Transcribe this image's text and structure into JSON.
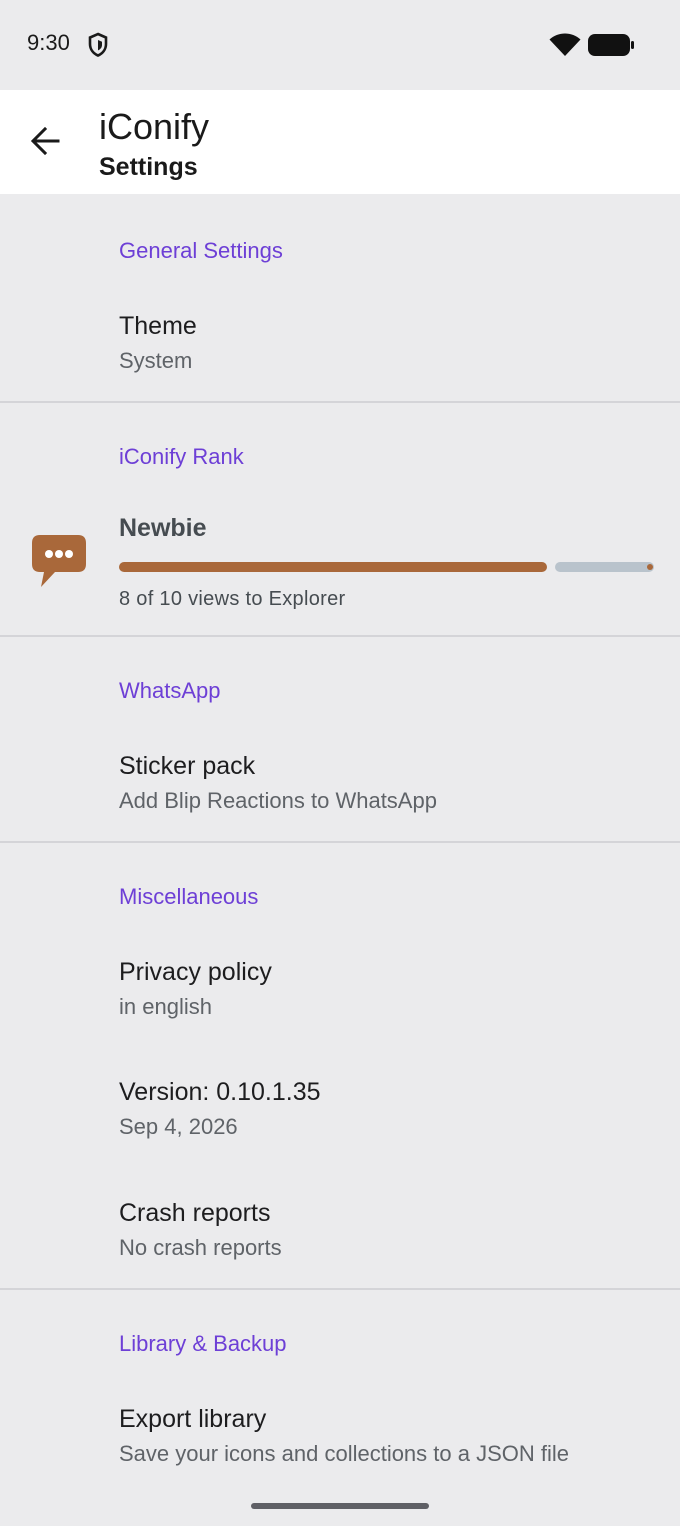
{
  "status_bar": {
    "time": "9:30",
    "icons": [
      "shield-icon",
      "wifi-icon",
      "battery-icon"
    ]
  },
  "app_bar": {
    "back_icon": "back-arrow-icon",
    "title": "iConify",
    "subtitle": "Settings"
  },
  "sections": {
    "general": {
      "header": "General Settings",
      "theme": {
        "title": "Theme",
        "summary": "System"
      }
    },
    "rank": {
      "header": "iConify Rank",
      "icon": "speech-bubble-icon",
      "level": "Newbie",
      "progress_current": 8,
      "progress_total": 10,
      "summary": "8 of 10 views to Explorer"
    },
    "whatsapp": {
      "header": "WhatsApp",
      "sticker": {
        "title": "Sticker pack",
        "summary": "Add Blip Reactions to WhatsApp"
      }
    },
    "misc": {
      "header": "Miscellaneous",
      "privacy": {
        "title": "Privacy policy",
        "summary": "in english"
      },
      "version": {
        "title": "Version: 0.10.1.35",
        "summary": "Sep 4, 2026"
      },
      "crash": {
        "title": "Crash reports",
        "summary": "No crash reports"
      }
    },
    "library": {
      "header": "Library & Backup",
      "export": {
        "title": "Export library",
        "summary": "Save your icons and collections to a JSON file"
      }
    }
  },
  "colors": {
    "accent": "#6d3fd6",
    "rank_brown": "#a9683a",
    "background": "#ebebed",
    "app_bar": "#ffffff"
  }
}
